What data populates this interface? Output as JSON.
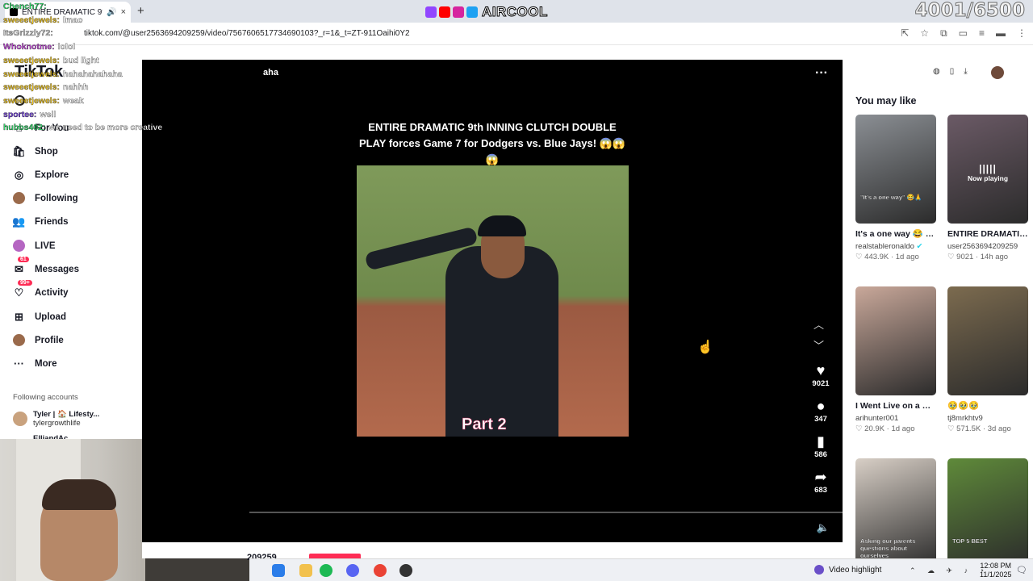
{
  "browser": {
    "tab_title": "ENTIRE DRAMATIC 9th INNI...",
    "tab_close": "×",
    "new_tab": "+",
    "url": "tiktok.com/@user2563694209259/video/7567606517734690103?_r=1&_t=ZT-911Oaihi0Y2"
  },
  "overlay": {
    "brand_name": "AIRCOOL",
    "goal_counter": "4001/6500",
    "chat": [
      {
        "user": "Chench77:",
        "msg": "",
        "color": "#32d96b"
      },
      {
        "user": "sweeetjewels:",
        "msg": "lmao",
        "color": "#f0c419"
      },
      {
        "user": "ItsGrizzly72:",
        "msg": "",
        "color": "#c9c9c9"
      },
      {
        "user": "Whoknotme:",
        "msg": "lolol",
        "color": "#c04ad7"
      },
      {
        "user": "sweeetjewels:",
        "msg": "bud light",
        "color": "#f0c419"
      },
      {
        "user": "sweeetjewels:",
        "msg": "hahahahahaha",
        "color": "#f0c419"
      },
      {
        "user": "sweeetjewels:",
        "msg": "nahhh",
        "color": "#f0c419"
      },
      {
        "user": "sweeetjewels:",
        "msg": "weak",
        "color": "#f0c419"
      },
      {
        "user": "sportee:",
        "msg": "well",
        "color": "#6f3fd9"
      },
      {
        "user": "hubbs402:",
        "msg": "we need to be more creative",
        "color": "#32d96b"
      }
    ]
  },
  "sidebar": {
    "logo": "TikTok",
    "items": [
      {
        "label": "For You",
        "icon": "home-icon",
        "glyph": "⌂"
      },
      {
        "label": "Shop",
        "icon": "shop-bag-icon",
        "glyph": "🛍"
      },
      {
        "label": "Explore",
        "icon": "compass-icon",
        "glyph": "◎"
      },
      {
        "label": "Following",
        "icon": "following-avatar-icon",
        "glyph": ""
      },
      {
        "label": "Friends",
        "icon": "friends-icon",
        "glyph": "👥"
      },
      {
        "label": "LIVE",
        "icon": "live-icon",
        "glyph": ""
      },
      {
        "label": "Messages",
        "icon": "messages-icon",
        "glyph": "✉",
        "badge": "61"
      },
      {
        "label": "Activity",
        "icon": "activity-icon",
        "glyph": "♡",
        "badge": "99+"
      },
      {
        "label": "Upload",
        "icon": "upload-icon",
        "glyph": "⊞"
      },
      {
        "label": "Profile",
        "icon": "profile-avatar-icon",
        "glyph": ""
      },
      {
        "label": "More",
        "icon": "more-dots-icon",
        "glyph": "···"
      }
    ],
    "following_header": "Following accounts",
    "following_accounts": [
      {
        "name": "Tyler | 🏠 Lifesty...",
        "username": "tylergrowthlife"
      },
      {
        "name": "ElliandAc...",
        "username": ""
      }
    ]
  },
  "player": {
    "uploader_fragment": "aha",
    "caption": "ENTIRE DRAMATIC 9th INNING CLUTCH DOUBLE PLAY forces Game 7 for Dodgers vs. Blue Jays! 😱😱😱",
    "overlay_text": "Part  2",
    "likes": "9021",
    "comments": "347",
    "saves": "586",
    "shares": "683"
  },
  "below_video": {
    "username_fragment": "209259"
  },
  "right": {
    "section_title": "You may like",
    "videos": [
      {
        "title": "It's a one way 😂 (Twitch -...",
        "author": "realstableronaldo",
        "verified": true,
        "likes": "443.9K",
        "age": "1d ago",
        "thumb_text": "\"It's a one way\" 😂🙏",
        "now_playing": "",
        "thumb_color": "#8b8f94"
      },
      {
        "title": "ENTIRE DRAMATIC 9th INNING CLUTC...",
        "author": "user2563694209259",
        "verified": false,
        "likes": "9021",
        "age": "14h ago",
        "thumb_text": "",
        "now_playing": "Now playing",
        "thumb_color": "#6b5a66"
      },
      {
        "title": "I Went Live on a Secret Channel Unt...",
        "author": "arihunter001",
        "verified": false,
        "likes": "20.9K",
        "age": "1d ago",
        "thumb_text": "",
        "now_playing": "",
        "thumb_color": "#c9a89a"
      },
      {
        "title": "🥹🥹🥹",
        "author": "tj8mrkhtv9",
        "verified": false,
        "likes": "571.5K",
        "age": "3d ago",
        "thumb_text": "",
        "now_playing": "",
        "thumb_color": "#7c6b4f"
      },
      {
        "title": "",
        "author": "",
        "verified": false,
        "likes": "",
        "age": "",
        "thumb_text": "Asking our parents questions about ourselves",
        "now_playing": "",
        "thumb_color": "#d8cfc6"
      },
      {
        "title": "",
        "author": "",
        "verified": false,
        "likes": "",
        "age": "",
        "thumb_text": "TOP 5 BEST",
        "now_playing": "",
        "thumb_color": "#5f8a3a"
      }
    ]
  },
  "taskbar": {
    "video_highlight": "Video highlight",
    "time": "12:08 PM",
    "date": "11/1/2025"
  },
  "colors": {
    "accent": "#fe2c55",
    "player_bg": "#000000"
  }
}
